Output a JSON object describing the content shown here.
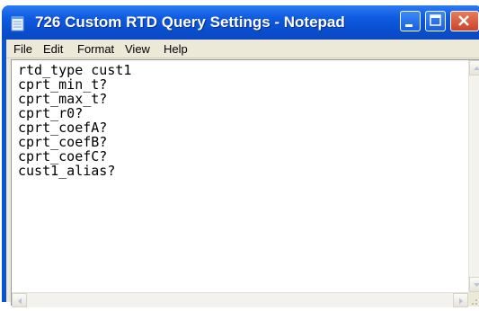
{
  "window": {
    "title": "726 Custom RTD Query Settings - Notepad"
  },
  "menu": {
    "items": [
      "File",
      "Edit",
      "Format",
      "View",
      "Help"
    ]
  },
  "editor": {
    "lines": [
      "rtd_type cust1",
      "cprt_min_t?",
      "cprt_max_t?",
      "cprt_r0?",
      "cprt_coefA?",
      "cprt_coefB?",
      "cprt_coefC?",
      "cust1_alias?"
    ]
  },
  "icons": {
    "app": "notepad-icon",
    "minimize": "minimize-icon",
    "maximize": "maximize-icon",
    "close": "close-icon",
    "scroll_up": "arrow-up-icon",
    "scroll_down": "arrow-down-icon",
    "scroll_left": "arrow-left-icon",
    "scroll_right": "arrow-right-icon"
  },
  "colors": {
    "titlebar": "#0a52d6",
    "close_button": "#c9452a",
    "chrome": "#ece9d8"
  }
}
